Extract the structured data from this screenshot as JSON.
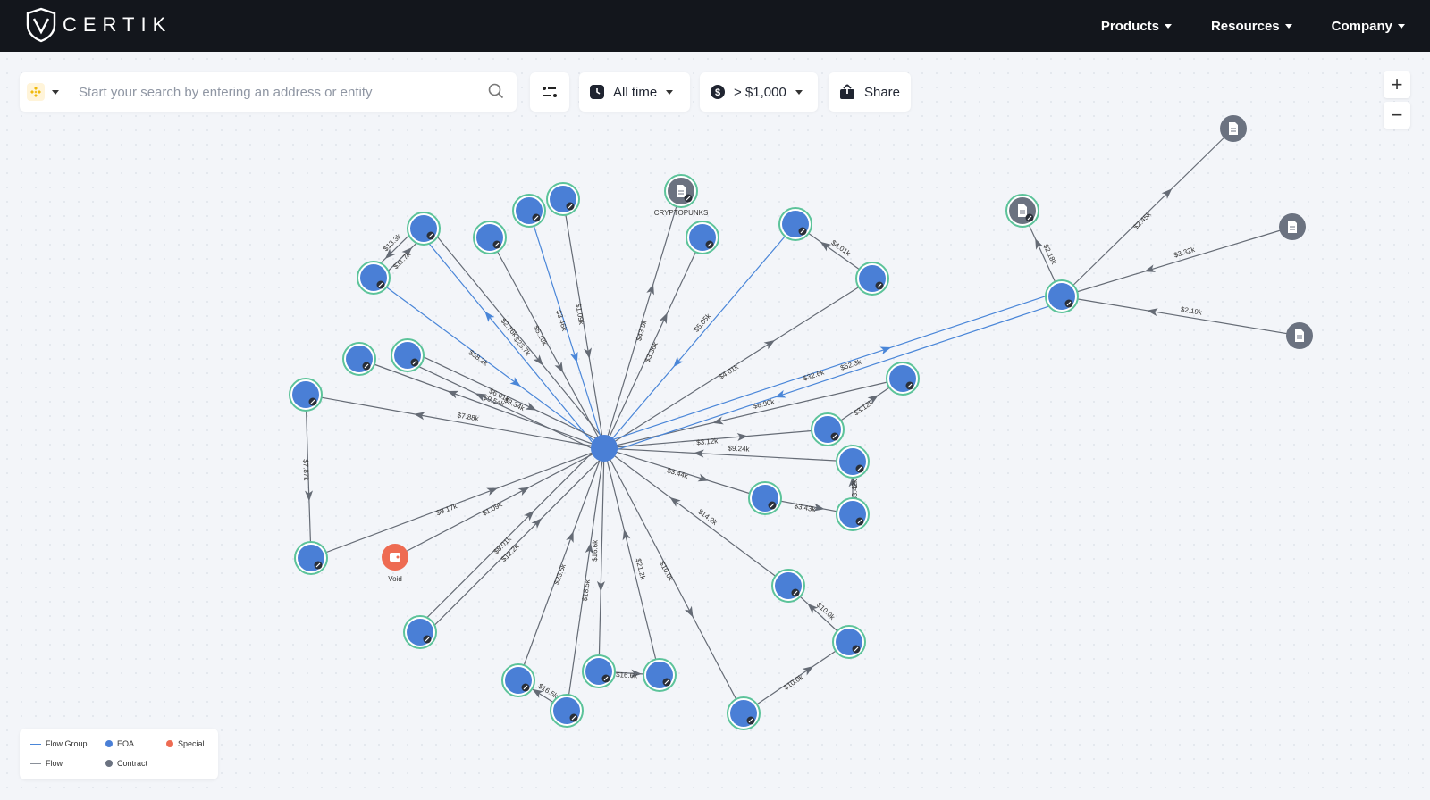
{
  "brand": {
    "name": "CERTIK"
  },
  "nav": {
    "products": "Products",
    "resources": "Resources",
    "company": "Company"
  },
  "search": {
    "placeholder": "Start your search by entering an address or entity",
    "chain_icon": "bnb-chain-icon"
  },
  "filters": {
    "time_label": "All time",
    "amount_label": "> $1,000",
    "share_label": "Share"
  },
  "zoom": {
    "in": "+",
    "out": "−"
  },
  "legend": {
    "flow_group": "Flow Group",
    "flow": "Flow",
    "eoa": "EOA",
    "contract": "Contract",
    "special": "Special"
  },
  "colors": {
    "eoa": "#4a7fd6",
    "contract": "#6b7280",
    "special": "#ee6b52",
    "flow_group": "#4a86d8",
    "flow": "#656b75",
    "node_ring": "#5cc39a"
  },
  "graph": {
    "nodes": [
      {
        "id": "center",
        "type": "eoa",
        "label": ""
      },
      {
        "id": "n1",
        "type": "eoa",
        "label": ""
      },
      {
        "id": "n2",
        "type": "eoa",
        "label": ""
      },
      {
        "id": "n3",
        "type": "eoa",
        "label": ""
      },
      {
        "id": "n4",
        "type": "eoa",
        "label": ""
      },
      {
        "id": "n5",
        "type": "eoa",
        "label": ""
      },
      {
        "id": "cryptopunks",
        "type": "contract",
        "label": "CRYPTOPUNKS"
      },
      {
        "id": "n7",
        "type": "eoa",
        "label": ""
      },
      {
        "id": "n8",
        "type": "eoa",
        "label": ""
      },
      {
        "id": "n9",
        "type": "eoa",
        "label": ""
      },
      {
        "id": "n10",
        "type": "eoa",
        "label": ""
      },
      {
        "id": "n11",
        "type": "eoa",
        "label": ""
      },
      {
        "id": "n12",
        "type": "eoa",
        "label": ""
      },
      {
        "id": "n13",
        "type": "eoa",
        "label": ""
      },
      {
        "id": "void",
        "type": "special",
        "label": "Void"
      },
      {
        "id": "n15",
        "type": "eoa",
        "label": ""
      },
      {
        "id": "n16",
        "type": "eoa",
        "label": ""
      },
      {
        "id": "n17",
        "type": "eoa",
        "label": ""
      },
      {
        "id": "n18",
        "type": "eoa",
        "label": ""
      },
      {
        "id": "n19",
        "type": "eoa",
        "label": ""
      },
      {
        "id": "n20",
        "type": "eoa",
        "label": ""
      },
      {
        "id": "n21",
        "type": "eoa",
        "label": ""
      },
      {
        "id": "n22",
        "type": "eoa",
        "label": ""
      },
      {
        "id": "n23",
        "type": "eoa",
        "label": ""
      },
      {
        "id": "n24",
        "type": "eoa",
        "label": ""
      },
      {
        "id": "n25",
        "type": "eoa",
        "label": ""
      },
      {
        "id": "n26",
        "type": "eoa",
        "label": ""
      },
      {
        "id": "n27",
        "type": "eoa",
        "label": ""
      },
      {
        "id": "n28",
        "type": "eoa",
        "label": ""
      },
      {
        "id": "hub",
        "type": "eoa",
        "label": ""
      },
      {
        "id": "c1",
        "type": "contract",
        "label": ""
      },
      {
        "id": "c2",
        "type": "contract",
        "label": ""
      },
      {
        "id": "c3",
        "type": "contract",
        "label": ""
      },
      {
        "id": "c4",
        "type": "contract",
        "label": ""
      }
    ],
    "edges": [
      {
        "from": "center",
        "to": "n1",
        "label": "$23.7k",
        "group": true
      },
      {
        "from": "n1",
        "to": "center",
        "label": "$2.16k",
        "group": false
      },
      {
        "from": "n2",
        "to": "center",
        "label": "$58.2k",
        "group": true
      },
      {
        "from": "n2",
        "to": "n1",
        "label": "$11.7k",
        "group": false
      },
      {
        "from": "n1",
        "to": "n2",
        "label": "$13.3k",
        "group": false
      },
      {
        "from": "n3",
        "to": "center",
        "label": "$5.18k",
        "group": false
      },
      {
        "from": "n4",
        "to": "center",
        "label": "$3.46k",
        "group": true
      },
      {
        "from": "n5",
        "to": "center",
        "label": "$1.09k",
        "group": false
      },
      {
        "from": "center",
        "to": "cryptopunks",
        "label": "$43.9k",
        "group": false
      },
      {
        "from": "center",
        "to": "n7",
        "label": "$3.36k",
        "group": false
      },
      {
        "from": "n8",
        "to": "center",
        "label": "$5.05k",
        "group": true
      },
      {
        "from": "n9",
        "to": "n8",
        "label": "$4.01k",
        "group": false
      },
      {
        "from": "center",
        "to": "n9",
        "label": "$4.01k",
        "group": false
      },
      {
        "from": "center",
        "to": "n10",
        "label": "$9.54k",
        "group": false
      },
      {
        "from": "center",
        "to": "n11",
        "label": "$3.34k",
        "group": false
      },
      {
        "from": "n11",
        "to": "center",
        "label": "$6.01k",
        "group": false
      },
      {
        "from": "center",
        "to": "n12",
        "label": "$7.88k",
        "group": false
      },
      {
        "from": "n12",
        "to": "n13",
        "label": "$7.87k",
        "group": false
      },
      {
        "from": "n13",
        "to": "center",
        "label": "$9.17k",
        "group": false
      },
      {
        "from": "void",
        "to": "center",
        "label": "$1.09k",
        "group": false
      },
      {
        "from": "n15",
        "to": "center",
        "label": "$12.2k",
        "group": false
      },
      {
        "from": "n15",
        "to": "center",
        "label": "$8.01k",
        "group": false
      },
      {
        "from": "n16",
        "to": "center",
        "label": "$23.5k",
        "group": false
      },
      {
        "from": "n17",
        "to": "n16",
        "label": "$16.5k",
        "group": false
      },
      {
        "from": "n17",
        "to": "center",
        "label": "$18.5k",
        "group": false
      },
      {
        "from": "center",
        "to": "n18",
        "label": "$16.6k",
        "group": false
      },
      {
        "from": "n18",
        "to": "n19",
        "label": "$16.6k",
        "group": false
      },
      {
        "from": "n19",
        "to": "center",
        "label": "$21.2k",
        "group": false
      },
      {
        "from": "center",
        "to": "n20",
        "label": "$10.0k",
        "group": false
      },
      {
        "from": "n20",
        "to": "n21",
        "label": "$10.0k",
        "group": false
      },
      {
        "from": "n21",
        "to": "n22",
        "label": "$10.0k",
        "group": false
      },
      {
        "from": "n22",
        "to": "center",
        "label": "$14.2k",
        "group": false
      },
      {
        "from": "center",
        "to": "n23",
        "label": "$3.44k",
        "group": false
      },
      {
        "from": "n23",
        "to": "n24",
        "label": "$3.43k",
        "group": false
      },
      {
        "from": "n24",
        "to": "n25",
        "label": "$3.42k",
        "group": false
      },
      {
        "from": "n25",
        "to": "center",
        "label": "$9.24k",
        "group": false
      },
      {
        "from": "center",
        "to": "n26",
        "label": "$3.12k",
        "group": false
      },
      {
        "from": "n26",
        "to": "n27",
        "label": "$3.12k",
        "group": false
      },
      {
        "from": "n27",
        "to": "center",
        "label": "$6.90k",
        "group": false
      },
      {
        "from": "center",
        "to": "hub",
        "label": "$32.6k",
        "group": true
      },
      {
        "from": "hub",
        "to": "center",
        "label": "$52.3k",
        "group": true
      },
      {
        "from": "hub",
        "to": "c1",
        "label": "$2.18k",
        "group": false
      },
      {
        "from": "hub",
        "to": "c2",
        "label": "$2.45k",
        "group": false
      },
      {
        "from": "c3",
        "to": "hub",
        "label": "$3.32k",
        "group": false
      },
      {
        "from": "c4",
        "to": "hub",
        "label": "$2.19k",
        "group": false
      }
    ]
  }
}
